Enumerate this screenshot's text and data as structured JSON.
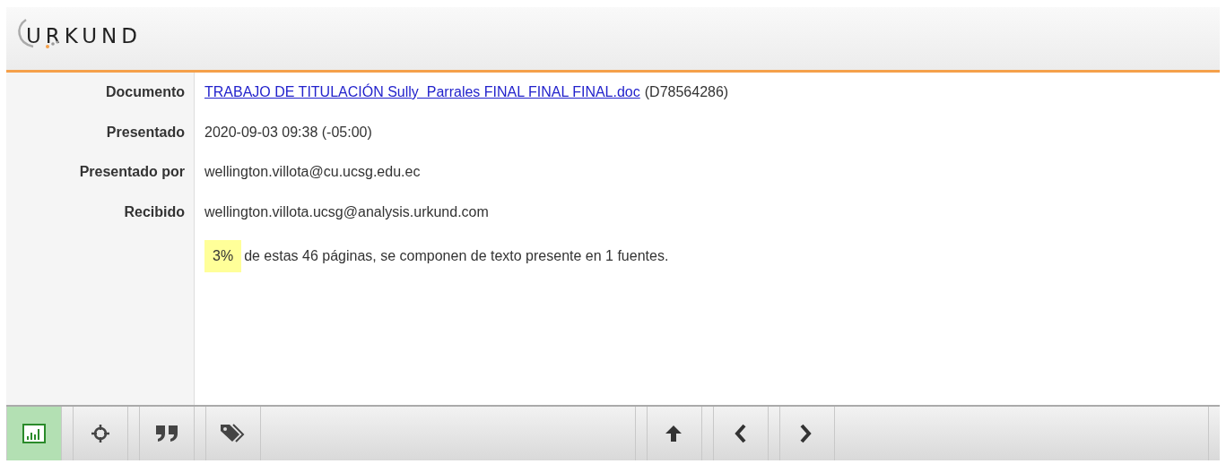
{
  "header": {
    "logo": "URKUND"
  },
  "fields": [
    {
      "kind": "link",
      "label": "Documento",
      "value": "TRABAJO DE TITULACIÓN Sully  Parrales FINAL FINAL FINAL.doc",
      "suffix": "(D78564286)"
    },
    {
      "kind": "text",
      "label": "Presentado",
      "value": "2020-09-03 09:38 (-05:00)"
    },
    {
      "kind": "text",
      "label": "Presentado por",
      "value": "wellington.villota@cu.ucsg.edu.ec"
    },
    {
      "kind": "text",
      "label": "Recibido",
      "value": "wellington.villota.ucsg@analysis.urkund.com"
    }
  ],
  "summary": {
    "percent": "3%",
    "text": "de estas 46 páginas, se componen de texto presente en 1 fuentes."
  },
  "toolbar": {
    "left": [
      {
        "selected": true
      },
      {
        "selected": false
      },
      {
        "selected": false
      },
      {
        "selected": false
      }
    ],
    "right": [
      {
        "selected": false
      },
      {
        "selected": false
      },
      {
        "selected": false
      }
    ]
  }
}
